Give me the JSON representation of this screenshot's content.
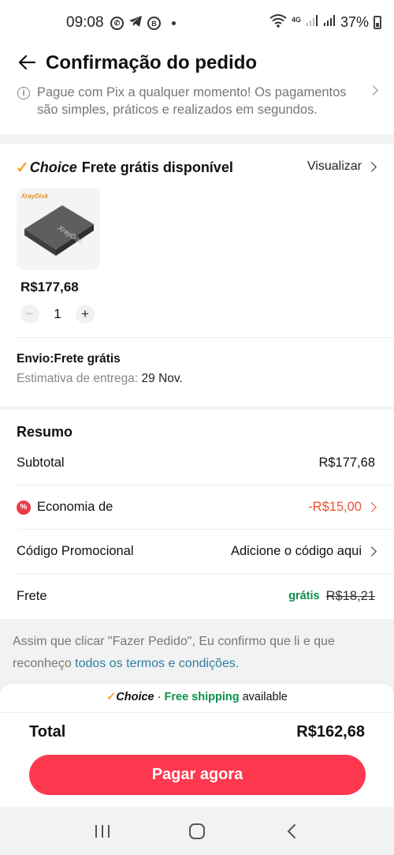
{
  "status_bar": {
    "time": "09:08",
    "network": "4G",
    "battery": "37%"
  },
  "header": {
    "title": "Confirmação do pedido"
  },
  "pix_notice": {
    "text": "Pague com Pix a qualquer momento! Os pagamentos são simples, práticos e realizados em segundos."
  },
  "product_section": {
    "choice_word": "Choice",
    "choice_text": "Frete grátis disponível",
    "view_label": "Visualizar",
    "brand": "XrayDisk",
    "price": "R$177,68",
    "quantity": "1",
    "minus": "−",
    "plus": "+",
    "shipping_title": "Envio:Frete grátis",
    "delivery_label": "Estimativa de entrega:",
    "delivery_date": "29 Nov."
  },
  "summary": {
    "title": "Resumo",
    "subtotal_label": "Subtotal",
    "subtotal_value": "R$177,68",
    "savings_label": "Economia de",
    "savings_value": "-R$15,00",
    "promo_label": "Código Promocional",
    "promo_value": "Adicione o código aqui",
    "shipping_label": "Frete",
    "shipping_free": "grátis",
    "shipping_old": "R$18,21"
  },
  "terms": {
    "text": "Assim que clicar \"Fazer Pedido\", Eu confirmo que li e que reconheço ",
    "link": "todos os termos e condições",
    "end": "."
  },
  "bottom": {
    "banner_choice": "Choice",
    "banner_dot": " · ",
    "banner_free": "Free shipping",
    "banner_available": " available",
    "total_label": "Total",
    "total_value": "R$162,68",
    "pay_label": "Pagar agora"
  },
  "colors": {
    "accent": "#fd384f",
    "choice": "#f5a623",
    "free_green": "#0c8f4b",
    "savings_red": "#e8512f",
    "link": "#2b7fa1"
  },
  "icons": [
    "whatsapp-icon",
    "telegram-icon",
    "b-icon",
    "wifi-icon",
    "signal-icon",
    "battery-icon",
    "back-arrow-icon",
    "info-icon",
    "chevron-right-icon",
    "discount-icon",
    "recent-apps-icon",
    "home-icon",
    "back-nav-icon"
  ]
}
